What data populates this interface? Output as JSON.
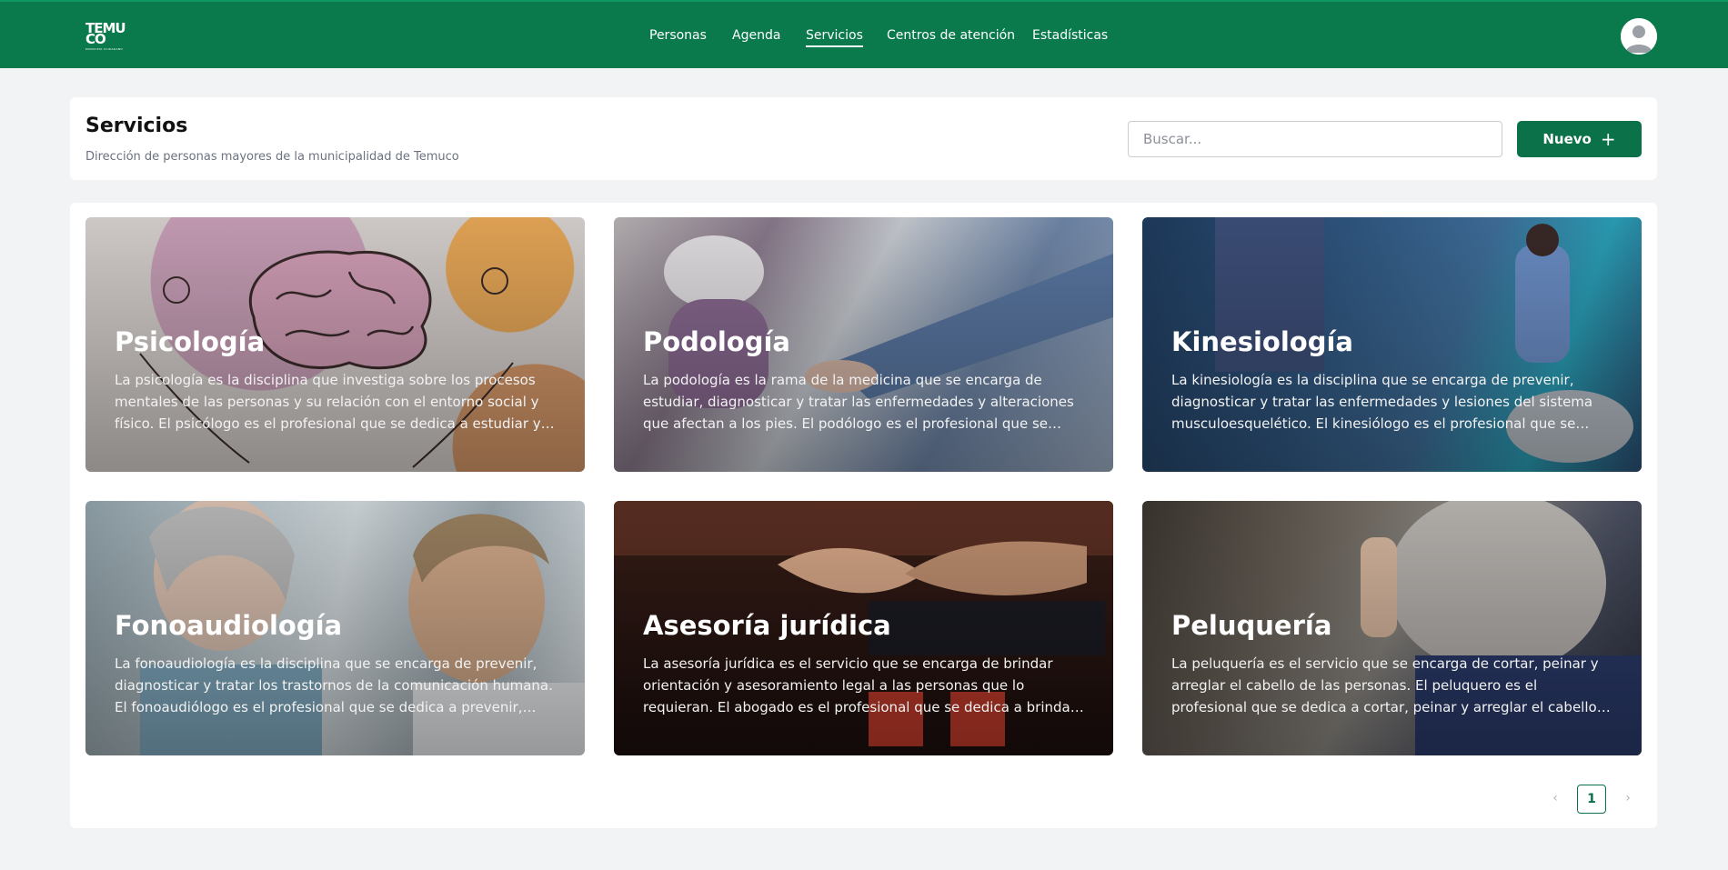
{
  "nav": {
    "logo": {
      "line1": "TEMU",
      "line2": "CO",
      "subtitle": "MUNICIPIO CIUDADANO"
    },
    "items": [
      {
        "label": "Personas",
        "active": false
      },
      {
        "label": "Agenda",
        "active": false
      },
      {
        "label": "Servicios",
        "active": true
      },
      {
        "label": "Centros de atención",
        "active": false
      },
      {
        "label": "Estadísticas",
        "active": false
      }
    ],
    "avatar_icon": "user-avatar-icon"
  },
  "header": {
    "title": "Servicios",
    "subtitle": "Dirección de personas mayores de la municipalidad de Temuco",
    "search_placeholder": "Buscar...",
    "new_button_label": "Nuevo",
    "new_button_icon": "plus-icon"
  },
  "services": [
    {
      "title": "Psicología",
      "description": "La psicología es la disciplina que investiga sobre los procesos mentales de las personas y su relación con el entorno social y físico. El psicólogo es el profesional que se dedica a estudiar y tratar los…"
    },
    {
      "title": "Podología",
      "description": "La podología es la rama de la medicina que se encarga de estudiar, diagnosticar y tratar las enfermedades y alteraciones que afectan a los pies. El podólogo es el profesional que se dedica a prevenir,…"
    },
    {
      "title": "Kinesiología",
      "description": "La kinesiología es la disciplina que se encarga de prevenir, diagnosticar y tratar las enfermedades y lesiones del sistema musculoesquelético. El kinesiólogo es el profesional que se dedic…"
    },
    {
      "title": "Fonoaudiología",
      "description": "La fonoaudiología es la disciplina que se encarga de prevenir, diagnosticar y tratar los trastornos de la comunicación humana. El fonoaudiólogo es el profesional que se dedica a prevenir,…"
    },
    {
      "title": "Asesoría jurídica",
      "description": "La asesoría jurídica es el servicio que se encarga de brindar orientación y asesoramiento legal a las personas que lo requieran. El abogado es el profesional que se dedica a brindar orientación y…"
    },
    {
      "title": "Peluquería",
      "description": "La peluquería es el servicio que se encarga de cortar, peinar y arreglar el cabello de las personas. El peluquero es el profesional que se dedica a cortar, peinar y arreglar el cabello de las personas."
    }
  ],
  "pagination": {
    "prev_icon": "chevron-left-icon",
    "next_icon": "chevron-right-icon",
    "prev_symbol": "‹",
    "next_symbol": "›",
    "current_page": "1"
  },
  "colors": {
    "brand": "#0a7a4d",
    "button": "#0a7148"
  }
}
